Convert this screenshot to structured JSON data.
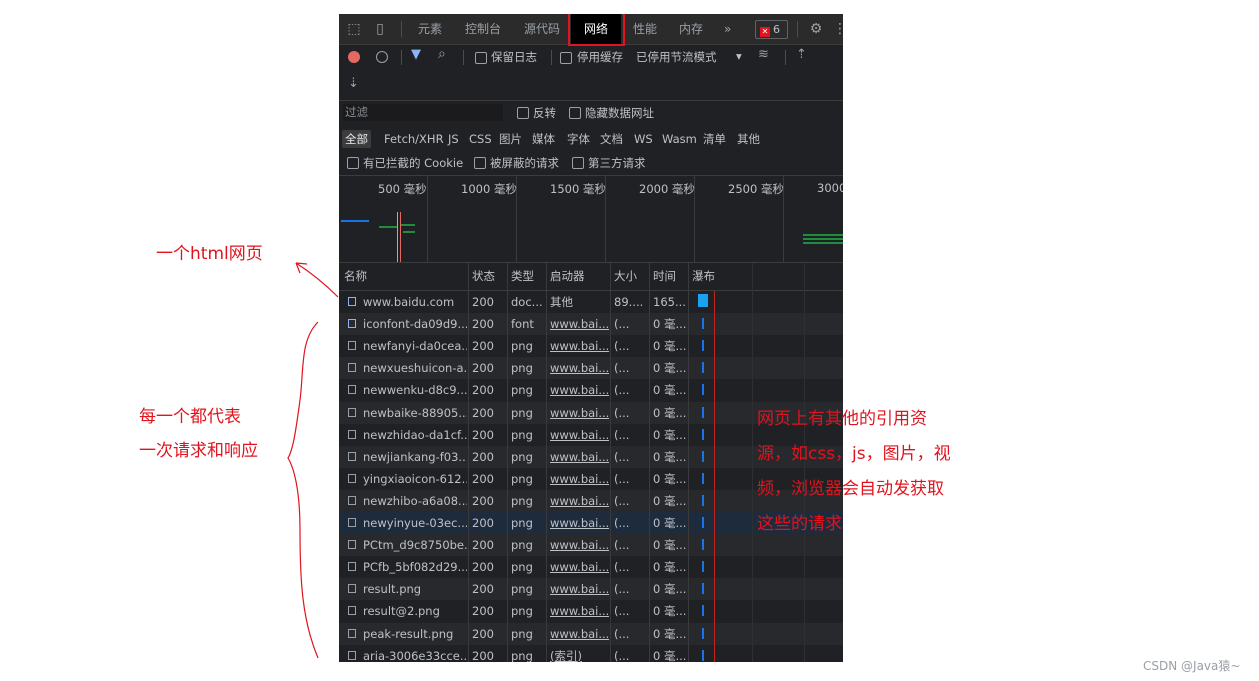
{
  "tabs": [
    "元素",
    "控制台",
    "源代码",
    "网络",
    "性能",
    "内存",
    "»"
  ],
  "error_count": "6",
  "toolbar": {
    "preserve_log": "保留日志",
    "disable_cache": "停用缓存",
    "throttle": "已停用节流模式",
    "throttle_arrow": "▾"
  },
  "filter": {
    "placeholder": "过滤",
    "invert": "反转",
    "hide_data_urls": "隐藏数据网址"
  },
  "types": [
    "全部",
    "Fetch/XHR",
    "JS",
    "CSS",
    "图片",
    "媒体",
    "字体",
    "文档",
    "WS",
    "Wasm",
    "清单",
    "其他"
  ],
  "cookie_row": {
    "blocked_cookies": "有已拦截的 Cookie",
    "blocked_requests": "被屏蔽的请求",
    "third_party": "第三方请求"
  },
  "overview_ticks": [
    "500 毫秒",
    "1000 毫秒",
    "1500 毫秒",
    "2000 毫秒",
    "2500 毫秒",
    "3000"
  ],
  "columns": [
    "名称",
    "状态",
    "类型",
    "启动器",
    "大小",
    "时间",
    "瀑布"
  ],
  "rows": [
    {
      "name": "www.baidu.com",
      "status": "200",
      "type": "doc...",
      "initiator": "其他",
      "size": "89....",
      "time": "165..."
    },
    {
      "name": "iconfont-da09d9...",
      "status": "200",
      "type": "font",
      "initiator": "www.bai...",
      "size": "(...",
      "time": "0 毫..."
    },
    {
      "name": "newfanyi-da0cea...",
      "status": "200",
      "type": "png",
      "initiator": "www.bai...",
      "size": "(...",
      "time": "0 毫..."
    },
    {
      "name": "newxueshuicon-a...",
      "status": "200",
      "type": "png",
      "initiator": "www.bai...",
      "size": "(...",
      "time": "0 毫..."
    },
    {
      "name": "newwenku-d8c9...",
      "status": "200",
      "type": "png",
      "initiator": "www.bai...",
      "size": "(...",
      "time": "0 毫..."
    },
    {
      "name": "newbaike-88905...",
      "status": "200",
      "type": "png",
      "initiator": "www.bai...",
      "size": "(...",
      "time": "0 毫..."
    },
    {
      "name": "newzhidao-da1cf...",
      "status": "200",
      "type": "png",
      "initiator": "www.bai...",
      "size": "(...",
      "time": "0 毫..."
    },
    {
      "name": "newjiankang-f03...",
      "status": "200",
      "type": "png",
      "initiator": "www.bai...",
      "size": "(...",
      "time": "0 毫..."
    },
    {
      "name": "yingxiaoicon-612...",
      "status": "200",
      "type": "png",
      "initiator": "www.bai...",
      "size": "(...",
      "time": "0 毫..."
    },
    {
      "name": "newzhibo-a6a08...",
      "status": "200",
      "type": "png",
      "initiator": "www.bai...",
      "size": "(...",
      "time": "0 毫..."
    },
    {
      "name": "newyinyue-03ec...",
      "status": "200",
      "type": "png",
      "initiator": "www.bai...",
      "size": "(...",
      "time": "0 毫..."
    },
    {
      "name": "PCtm_d9c8750be...",
      "status": "200",
      "type": "png",
      "initiator": "www.bai...",
      "size": "(...",
      "time": "0 毫..."
    },
    {
      "name": "PCfb_5bf082d29...",
      "status": "200",
      "type": "png",
      "initiator": "www.bai...",
      "size": "(...",
      "time": "0 毫..."
    },
    {
      "name": "result.png",
      "status": "200",
      "type": "png",
      "initiator": "www.bai...",
      "size": "(...",
      "time": "0 毫..."
    },
    {
      "name": "result@2.png",
      "status": "200",
      "type": "png",
      "initiator": "www.bai...",
      "size": "(...",
      "time": "0 毫..."
    },
    {
      "name": "peak-result.png",
      "status": "200",
      "type": "png",
      "initiator": "www.bai...",
      "size": "(...",
      "time": "0 毫..."
    },
    {
      "name": "aria-3006e33cce...",
      "status": "200",
      "type": "png",
      "initiator": "(索引)",
      "size": "(...",
      "time": "0 毫..."
    }
  ],
  "annotations": {
    "html_page": "一个html网页",
    "each_line1": "每一个都代表",
    "each_line2": "一次请求和响应",
    "right_line1": "网页上有其他的引用资",
    "right_line2": "源，如css，js，图片，视",
    "right_line3": "频，浏览器会自动发获取",
    "right_line4": "这些的请求"
  },
  "watermark": "CSDN @Java猿~",
  "colors": {
    "annotation_red": "#e0141e",
    "panel_bg": "#202124",
    "record_red": "#e46962",
    "waterfall_blue": "#1a73e8",
    "active_tab_bg": "#000000"
  }
}
